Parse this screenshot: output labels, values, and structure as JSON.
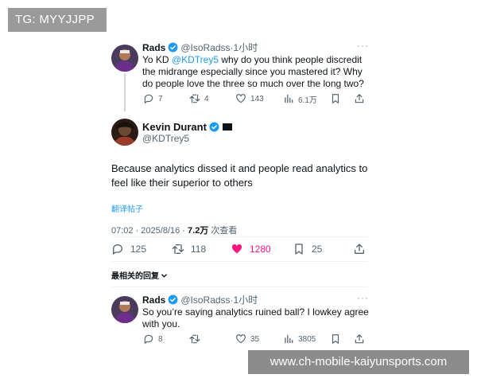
{
  "watermark": {
    "top_left": "TG: MYYJJPP",
    "bottom_right": "www.ch-mobile-kaiyunsports.com"
  },
  "colors": {
    "accent": "#1d9bf0",
    "like_active": "#f91880",
    "text": "#0f1419",
    "muted": "#536471"
  },
  "parent_tweet": {
    "name": "Rads",
    "handle": "@IsoRadss",
    "time": "·1小时",
    "text_prefix": "Yo KD ",
    "mention": "@KDTrey5",
    "text_suffix": " why do you think people discredit the midrange especially since you mastered it? Why do people love the three so much over the long two?",
    "replies": "7",
    "retweets": "4",
    "likes": "143",
    "views": "6.1万"
  },
  "main_tweet": {
    "name": "Kevin Durant",
    "handle": "@KDTrey5",
    "text": "Because analytics dissed it and people read analytics to feel like their superior to others",
    "translate": "翻译帖子",
    "timestamp": "07:02 · 2025/8/16 · ",
    "views_count": "7.2万",
    "views_label": " 次查看",
    "replies": "125",
    "retweets": "118",
    "likes": "1280",
    "bookmarks": "25"
  },
  "sort_label": "最相关的回复",
  "reply_tweet": {
    "name": "Rads",
    "handle": "@IsoRadss",
    "time": "·1小时",
    "text": "So you’re saying analytics ruined ball? I lowkey agree with you.",
    "replies": "8",
    "retweets": "",
    "likes": "35",
    "views": "3805"
  }
}
